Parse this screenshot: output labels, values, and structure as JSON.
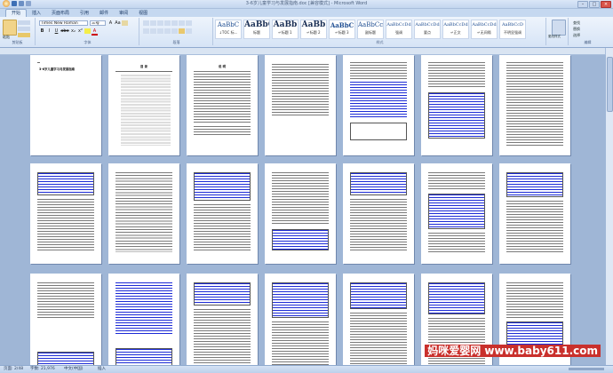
{
  "window": {
    "title": "3-6岁儿童学习与发展指南.doc [兼容模式] - Microsoft Word",
    "min": "–",
    "max": "□",
    "close": "×"
  },
  "tabs": [
    "开始",
    "插入",
    "页面布局",
    "引用",
    "邮件",
    "审阅",
    "视图"
  ],
  "ribbon": {
    "clipboard": {
      "paste": "粘贴",
      "label": "剪贴板"
    },
    "font": {
      "name": "Times New Roman",
      "size": "三号",
      "label": "字体",
      "bold": "B",
      "italic": "I",
      "underline": "U",
      "strike": "abe",
      "sub": "x₂",
      "sup": "x²",
      "clear": "Aa",
      "grow": "A",
      "color": "A"
    },
    "paragraph": {
      "label": "段落"
    },
    "styles": {
      "label": "样式",
      "items": [
        {
          "preview": "AaBbC",
          "name": "↓TOC 标..."
        },
        {
          "preview": "AaBbC",
          "name": "标题"
        },
        {
          "preview": "AaBb",
          "name": "↵标题 1"
        },
        {
          "preview": "AaBb",
          "name": "↵标题 2"
        },
        {
          "preview": "AaBbC",
          "name": "↵标题 3"
        },
        {
          "preview": "AaBbCcD",
          "name": "副标题"
        },
        {
          "preview": "AaBbCcDd",
          "name": "强调"
        },
        {
          "preview": "AaBbCcDd",
          "name": "要点"
        },
        {
          "preview": "AaBbCcDd",
          "name": "↵正文"
        },
        {
          "preview": "AaBbCcDd",
          "name": "↵无间隔"
        },
        {
          "preview": "AaBbCcD",
          "name": "不明显强调"
        },
        {
          "preview": "AaBbCcDd",
          "name": "明显强调"
        },
        {
          "preview": "AaBbCcDd",
          "name": "引用"
        },
        {
          "preview": "AaBbCcDd",
          "name": "明显引用"
        }
      ],
      "change": "更改样式"
    },
    "editing": {
      "find": "查找",
      "replace": "替换",
      "select": "选择",
      "label": "编辑"
    }
  },
  "status": {
    "page": "页面: 2/48",
    "words": "字数: 21,976",
    "lang": "中文(中国)",
    "mode": "插入"
  },
  "watermark": "妈咪爱婴网 www.baby611.com",
  "doc": {
    "title_page": "3-6岁儿童学习与发展指南",
    "toc_heading": "目  录",
    "preface_heading": "说  明"
  },
  "colors": {
    "accent": "#1d2bd6",
    "ribbon": "#d6e4f6"
  }
}
